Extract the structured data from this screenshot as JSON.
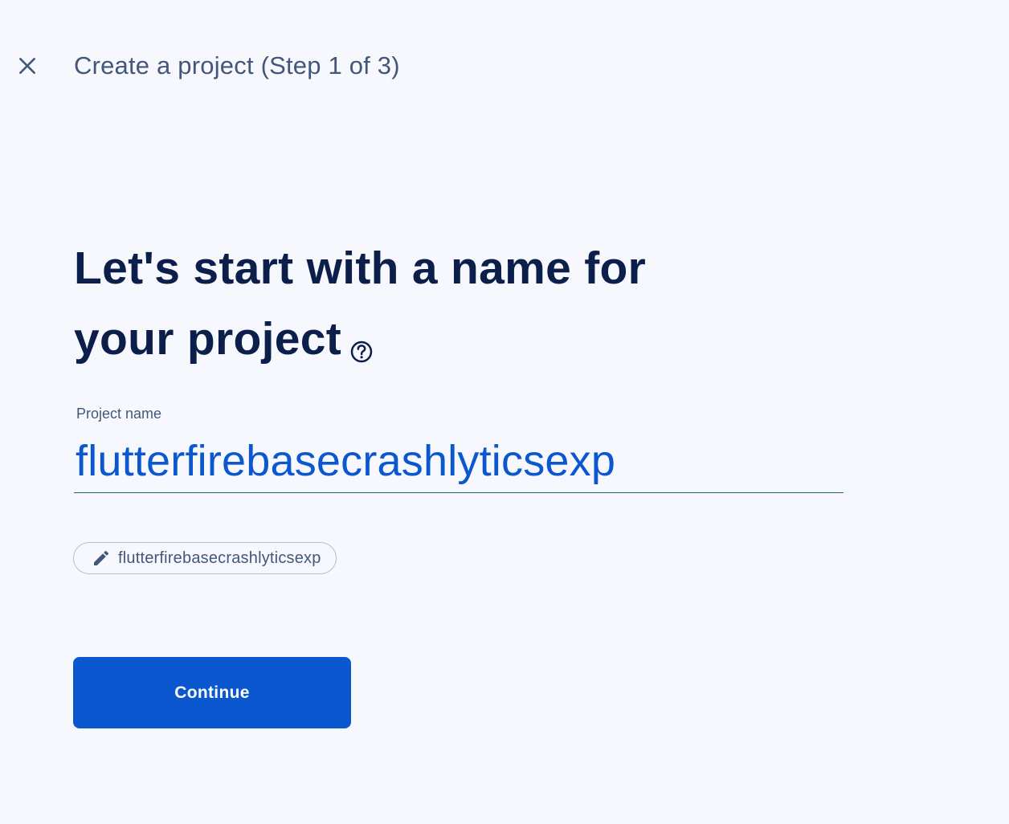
{
  "header": {
    "close_icon": "close-icon",
    "title": "Create a project (Step 1 of 3)"
  },
  "main": {
    "heading_line1": "Let's start with a name for",
    "heading_line2": "your project",
    "help_icon": "help-circle-icon",
    "field_label": "Project name",
    "project_name_value": "flutterfirebasecrashlyticsexp",
    "project_id_chip": "flutterfirebasecrashlyticsexp",
    "edit_icon": "pencil-icon",
    "continue_label": "Continue"
  },
  "colors": {
    "background": "#f6f8fe",
    "accent": "#0b57d0",
    "heading": "#0c1e4a",
    "secondary_text": "#44577a",
    "underline": "#1e6b5c"
  }
}
